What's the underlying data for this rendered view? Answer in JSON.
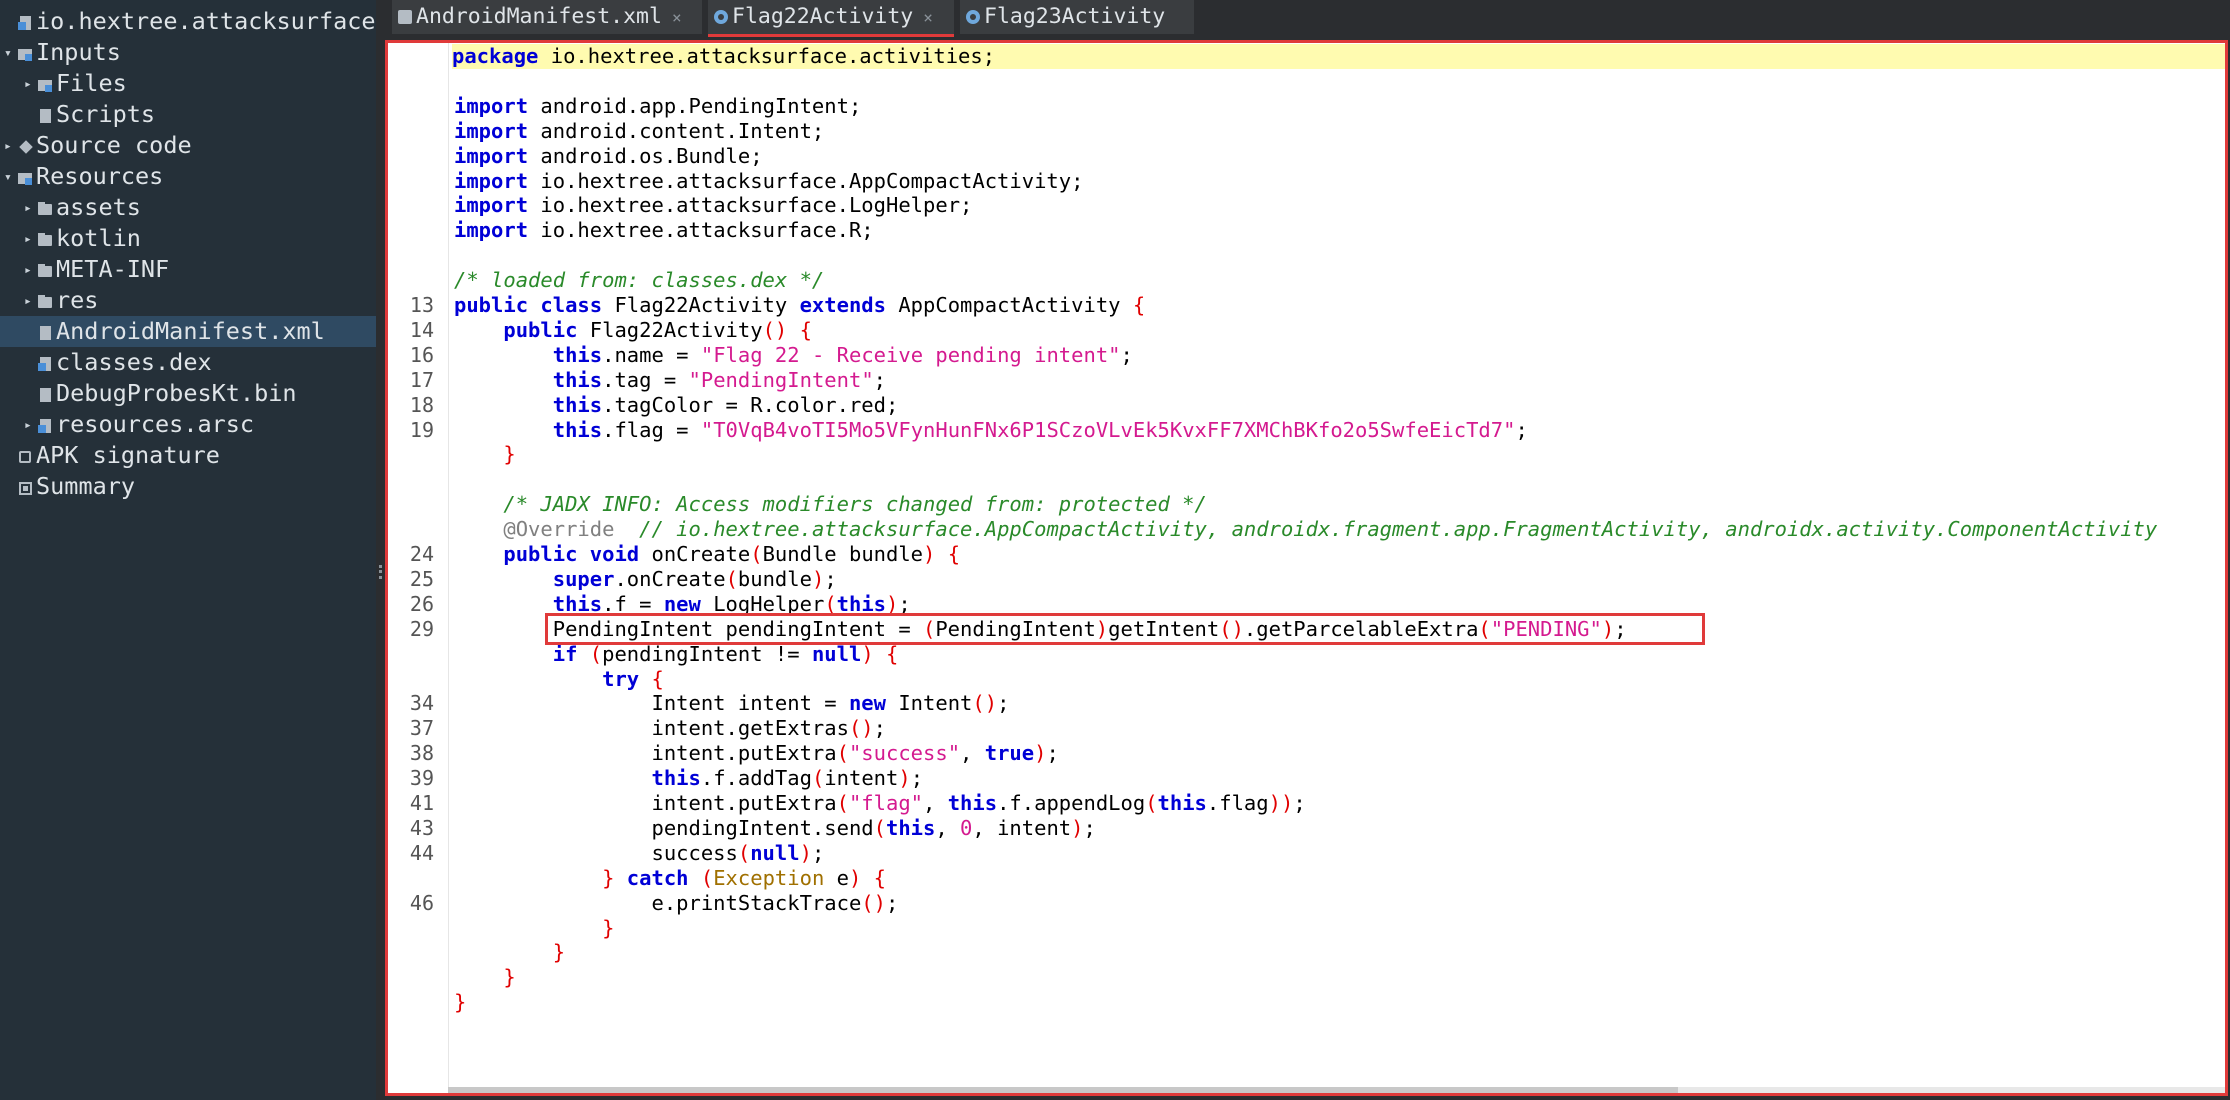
{
  "tree": [
    {
      "label": "io.hextree.attacksurface.",
      "icon": "file-blue",
      "arrow": "",
      "depth": 0
    },
    {
      "label": "Inputs",
      "icon": "folder-blue",
      "arrow": "▾",
      "depth": 0
    },
    {
      "label": "Files",
      "icon": "folder-blue",
      "arrow": "▸",
      "depth": 1
    },
    {
      "label": "Scripts",
      "icon": "file",
      "arrow": "",
      "depth": 1
    },
    {
      "label": "Source code",
      "icon": "cube",
      "arrow": "▸",
      "depth": 0
    },
    {
      "label": "Resources",
      "icon": "folder-blue",
      "arrow": "▾",
      "depth": 0
    },
    {
      "label": "assets",
      "icon": "folder",
      "arrow": "▸",
      "depth": 1
    },
    {
      "label": "kotlin",
      "icon": "folder",
      "arrow": "▸",
      "depth": 1
    },
    {
      "label": "META-INF",
      "icon": "folder",
      "arrow": "▸",
      "depth": 1
    },
    {
      "label": "res",
      "icon": "folder",
      "arrow": "▸",
      "depth": 1
    },
    {
      "label": "AndroidManifest.xml",
      "icon": "file",
      "arrow": "",
      "depth": 1,
      "selected": true
    },
    {
      "label": "classes.dex",
      "icon": "file-blue",
      "arrow": "",
      "depth": 1
    },
    {
      "label": "DebugProbesKt.bin",
      "icon": "file",
      "arrow": "",
      "depth": 1
    },
    {
      "label": "resources.arsc",
      "icon": "file-blue",
      "arrow": "▸",
      "depth": 1
    },
    {
      "label": "APK signature",
      "icon": "sig",
      "arrow": "",
      "depth": 0
    },
    {
      "label": "Summary",
      "icon": "sum",
      "arrow": "",
      "depth": 0
    }
  ],
  "tabs": [
    {
      "label": "AndroidManifest.xml",
      "icon": "xml",
      "active": false
    },
    {
      "label": "Flag22Activity",
      "icon": "class",
      "active": true
    },
    {
      "label": "Flag23Activity",
      "icon": "class",
      "active": false
    }
  ],
  "tab_close": "×",
  "code": [
    {
      "ln": "",
      "hl": true,
      "t": [
        [
          "kw",
          "package"
        ],
        [
          "",
          "io.hextree.attacksurface.activities;"
        ]
      ]
    },
    {
      "ln": "",
      "t": []
    },
    {
      "ln": "",
      "t": [
        [
          "kw",
          "import"
        ],
        [
          "",
          "android.app.PendingIntent;"
        ]
      ]
    },
    {
      "ln": "",
      "t": [
        [
          "kw",
          "import"
        ],
        [
          "",
          "android.content.Intent;"
        ]
      ]
    },
    {
      "ln": "",
      "t": [
        [
          "kw",
          "import"
        ],
        [
          "",
          "android.os.Bundle;"
        ]
      ]
    },
    {
      "ln": "",
      "t": [
        [
          "kw",
          "import"
        ],
        [
          "",
          "io.hextree.attacksurface.AppCompactActivity;"
        ]
      ]
    },
    {
      "ln": "",
      "t": [
        [
          "kw",
          "import"
        ],
        [
          "",
          "io.hextree.attacksurface.LogHelper;"
        ]
      ]
    },
    {
      "ln": "",
      "t": [
        [
          "kw",
          "import"
        ],
        [
          "",
          "io.hextree.attacksurface.R;"
        ]
      ]
    },
    {
      "ln": "",
      "t": []
    },
    {
      "ln": "",
      "t": [
        [
          "cm",
          "/* loaded from: classes.dex */"
        ]
      ]
    },
    {
      "ln": "13",
      "t": [
        [
          "kw",
          "public class"
        ],
        [
          "",
          "Flag22Activity"
        ],
        [
          "kw",
          "extends"
        ],
        [
          "",
          "AppCompactActivity"
        ],
        [
          "pn",
          "{"
        ]
      ]
    },
    {
      "ln": "14",
      "t": [
        [
          "",
          "    "
        ],
        [
          "kw",
          "public"
        ],
        [
          "",
          "Flag22Activity"
        ],
        [
          "pn",
          "() {"
        ]
      ]
    },
    {
      "ln": "16",
      "t": [
        [
          "",
          "        "
        ],
        [
          "kw",
          "this"
        ],
        [
          "",
          ".name = "
        ],
        [
          "str",
          "\"Flag 22 - Receive pending intent\""
        ],
        [
          "",
          ";"
        ]
      ]
    },
    {
      "ln": "17",
      "t": [
        [
          "",
          "        "
        ],
        [
          "kw",
          "this"
        ],
        [
          "",
          ".tag = "
        ],
        [
          "str",
          "\"PendingIntent\""
        ],
        [
          "",
          ";"
        ]
      ]
    },
    {
      "ln": "18",
      "t": [
        [
          "",
          "        "
        ],
        [
          "kw",
          "this"
        ],
        [
          "",
          ".tagColor = R.color.red;"
        ]
      ]
    },
    {
      "ln": "19",
      "t": [
        [
          "",
          "        "
        ],
        [
          "kw",
          "this"
        ],
        [
          "",
          ".flag = "
        ],
        [
          "str",
          "\"T0VqB4voTI5Mo5VFynHunFNx6P1SCzoVLvEk5KvxFF7XMChBKfo2o5SwfeEicTd7\""
        ],
        [
          "",
          ";"
        ]
      ]
    },
    {
      "ln": "",
      "t": [
        [
          "",
          "    "
        ],
        [
          "pn",
          "}"
        ]
      ]
    },
    {
      "ln": "",
      "t": []
    },
    {
      "ln": "",
      "t": [
        [
          "",
          "    "
        ],
        [
          "cm",
          "/* JADX INFO: Access modifiers changed from: protected */"
        ]
      ]
    },
    {
      "ln": "",
      "t": [
        [
          "",
          "    "
        ],
        [
          "ann",
          "@Override"
        ],
        [
          "cm",
          " // io.hextree.attacksurface.AppCompactActivity, androidx.fragment.app.FragmentActivity, androidx.activity.ComponentActivity"
        ]
      ]
    },
    {
      "ln": "24",
      "t": [
        [
          "",
          "    "
        ],
        [
          "kw",
          "public void"
        ],
        [
          "",
          "onCreate"
        ],
        [
          "pn",
          "("
        ],
        [
          "",
          "Bundle bundle"
        ],
        [
          "pn",
          ") {"
        ]
      ]
    },
    {
      "ln": "25",
      "t": [
        [
          "",
          "        "
        ],
        [
          "kw",
          "super"
        ],
        [
          "",
          ".onCreate"
        ],
        [
          "pn",
          "("
        ],
        [
          "",
          "bundle"
        ],
        [
          "pn",
          ")"
        ],
        [
          "",
          ";"
        ]
      ]
    },
    {
      "ln": "26",
      "t": [
        [
          "",
          "        "
        ],
        [
          "kw",
          "this"
        ],
        [
          "",
          ".f = "
        ],
        [
          "kw",
          "new"
        ],
        [
          "",
          "LogHelper"
        ],
        [
          "pn",
          "("
        ],
        [
          "kw",
          "this"
        ],
        [
          "pn",
          ")"
        ],
        [
          "",
          ";"
        ]
      ]
    },
    {
      "ln": "29",
      "t": [
        [
          "",
          "        PendingIntent pendingIntent = "
        ],
        [
          "pn",
          "("
        ],
        [
          "",
          "PendingIntent"
        ],
        [
          "pn",
          ")"
        ],
        [
          "",
          ""
        ],
        [
          "",
          "getIntent"
        ],
        [
          "pn",
          "()"
        ],
        [
          "",
          ".getParcelableExtra"
        ],
        [
          "pn",
          "("
        ],
        [
          "str",
          "\"PENDING\""
        ],
        [
          "pn",
          ")"
        ],
        [
          "",
          ";"
        ]
      ]
    },
    {
      "ln": "",
      "t": [
        [
          "",
          "        "
        ],
        [
          "kw",
          "if"
        ],
        [
          "pn",
          "("
        ],
        [
          "",
          "pendingIntent != "
        ],
        [
          "kw",
          "null"
        ],
        [
          "pn",
          ") {"
        ]
      ]
    },
    {
      "ln": "",
      "t": [
        [
          "",
          "            "
        ],
        [
          "kw",
          "try"
        ],
        [
          "pn",
          "{"
        ]
      ]
    },
    {
      "ln": "34",
      "t": [
        [
          "",
          "                Intent intent = "
        ],
        [
          "kw",
          "new"
        ],
        [
          "",
          "Intent"
        ],
        [
          "pn",
          "()"
        ],
        [
          "",
          ";"
        ]
      ]
    },
    {
      "ln": "37",
      "t": [
        [
          "",
          "                intent.getExtras"
        ],
        [
          "pn",
          "()"
        ],
        [
          "",
          ";"
        ]
      ]
    },
    {
      "ln": "38",
      "t": [
        [
          "",
          "                intent.putExtra"
        ],
        [
          "pn",
          "("
        ],
        [
          "str",
          "\"success\""
        ],
        [
          "",
          ", "
        ],
        [
          "kw",
          "true"
        ],
        [
          "pn",
          ")"
        ],
        [
          "",
          ";"
        ]
      ]
    },
    {
      "ln": "39",
      "t": [
        [
          "",
          "                "
        ],
        [
          "kw",
          "this"
        ],
        [
          "",
          ".f.addTag"
        ],
        [
          "pn",
          "("
        ],
        [
          "",
          "intent"
        ],
        [
          "pn",
          ")"
        ],
        [
          "",
          ";"
        ]
      ]
    },
    {
      "ln": "41",
      "t": [
        [
          "",
          "                intent.putExtra"
        ],
        [
          "pn",
          "("
        ],
        [
          "str",
          "\"flag\""
        ],
        [
          "",
          ", "
        ],
        [
          "kw",
          "this"
        ],
        [
          "",
          ".f.appendLog"
        ],
        [
          "pn",
          "("
        ],
        [
          "kw",
          "this"
        ],
        [
          "",
          ".flag"
        ],
        [
          "pn",
          "))"
        ],
        [
          "",
          ";"
        ]
      ]
    },
    {
      "ln": "43",
      "t": [
        [
          "",
          "                pendingIntent.send"
        ],
        [
          "pn",
          "("
        ],
        [
          "kw",
          "this"
        ],
        [
          "",
          ", "
        ],
        [
          "num",
          "0"
        ],
        [
          "",
          ", intent"
        ],
        [
          "pn",
          ")"
        ],
        [
          "",
          ";"
        ]
      ]
    },
    {
      "ln": "44",
      "t": [
        [
          "",
          "                success"
        ],
        [
          "pn",
          "("
        ],
        [
          "kw",
          "null"
        ],
        [
          "pn",
          ")"
        ],
        [
          "",
          ";"
        ]
      ]
    },
    {
      "ln": "",
      "t": [
        [
          "",
          "            "
        ],
        [
          "pn",
          "}"
        ],
        [
          "kw",
          "catch"
        ],
        [
          "pn",
          "("
        ],
        [
          "ex",
          "Exception"
        ],
        [
          "",
          "e"
        ],
        [
          "pn",
          ") {"
        ]
      ]
    },
    {
      "ln": "46",
      "t": [
        [
          "",
          "                e.printStackTrace"
        ],
        [
          "pn",
          "()"
        ],
        [
          "",
          ";"
        ]
      ]
    },
    {
      "ln": "",
      "t": [
        [
          "",
          "            "
        ],
        [
          "pn",
          "}"
        ]
      ]
    },
    {
      "ln": "",
      "t": [
        [
          "",
          "        "
        ],
        [
          "pn",
          "}"
        ]
      ]
    },
    {
      "ln": "",
      "t": [
        [
          "",
          "    "
        ],
        [
          "pn",
          "}"
        ]
      ]
    },
    {
      "ln": "",
      "t": [
        [
          "pn",
          "}"
        ]
      ]
    }
  ],
  "colors": {
    "accent": "#e03a3a",
    "keyword": "#0000d6",
    "string": "#d41a8f",
    "comment": "#2a8a2a",
    "sidebar": "#253039",
    "selected": "#2f4a62"
  }
}
